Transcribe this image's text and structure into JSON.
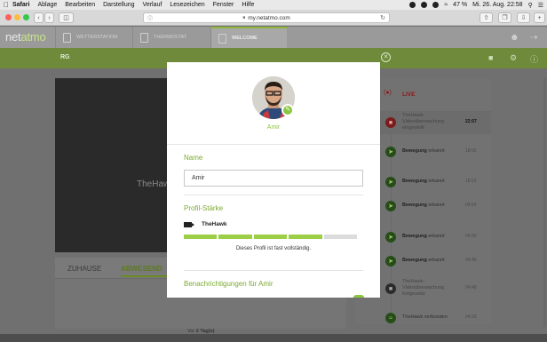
{
  "menubar": {
    "items": [
      "Safari",
      "Ablage",
      "Bearbeiten",
      "Darstellung",
      "Verlauf",
      "Lesezeichen",
      "Fenster",
      "Hilfe"
    ],
    "datetime": "Mi. 26. Aug.  22:58",
    "battery": "47 %"
  },
  "browser": {
    "url": "my.netatmo.com"
  },
  "app": {
    "logo_left": "net",
    "logo_right": "atmo",
    "tabs": [
      "WETTERSTATION",
      "THERMOSTAT",
      "WELCOME"
    ],
    "home_name": "RG"
  },
  "video": {
    "camera_name": "TheHawk"
  },
  "home_panel": {
    "tabs": [
      "ZUHAUSE",
      "ABWESEND"
    ],
    "last_seen_prefix": "Vor ",
    "last_seen_value": "2 Tag(e)"
  },
  "timeline": {
    "live_label": "LIVE",
    "events": [
      {
        "text": "TheHawk-Videoüberwachung eingestellt",
        "time": "22:57",
        "icon": "stop-icon",
        "bold_time": true
      },
      {
        "bold": "Bewegung",
        "text": " erkannt",
        "time": "18:02",
        "icon": "motion-icon"
      },
      {
        "bold": "Bewegung",
        "text": " erkannt",
        "time": "18:01",
        "icon": "motion-icon"
      },
      {
        "bold": "Bewegung",
        "text": " erkannt",
        "time": "04:54",
        "icon": "motion-icon"
      },
      {
        "bold": "Bewegung",
        "text": " erkannt",
        "time": "04:50",
        "icon": "motion-icon"
      },
      {
        "bold": "Bewegung",
        "text": " erkannt",
        "time": "04:49",
        "icon": "motion-icon"
      },
      {
        "text": "TheHawk-Videoüberwachung fortgesetzt",
        "time": "04:48",
        "icon": "camera-icon"
      },
      {
        "text": "TheHawk verbunden",
        "time": "04:23",
        "icon": "wifi-icon"
      }
    ]
  },
  "modal": {
    "person_name": "Amir",
    "name_label": "Name",
    "name_value": "Amir",
    "profile_label": "Profil-Stärke",
    "camera_name": "TheHawk",
    "profile_strength": 0.8,
    "profile_segments": 5,
    "profile_status": "Dieses Profil ist fast vollständig.",
    "notifications_label": "Benachrichtigungen für Amir"
  },
  "colors": {
    "accent_green": "#8cc63f",
    "label_green": "#7aaa2e",
    "live_red": "#d0021b"
  }
}
